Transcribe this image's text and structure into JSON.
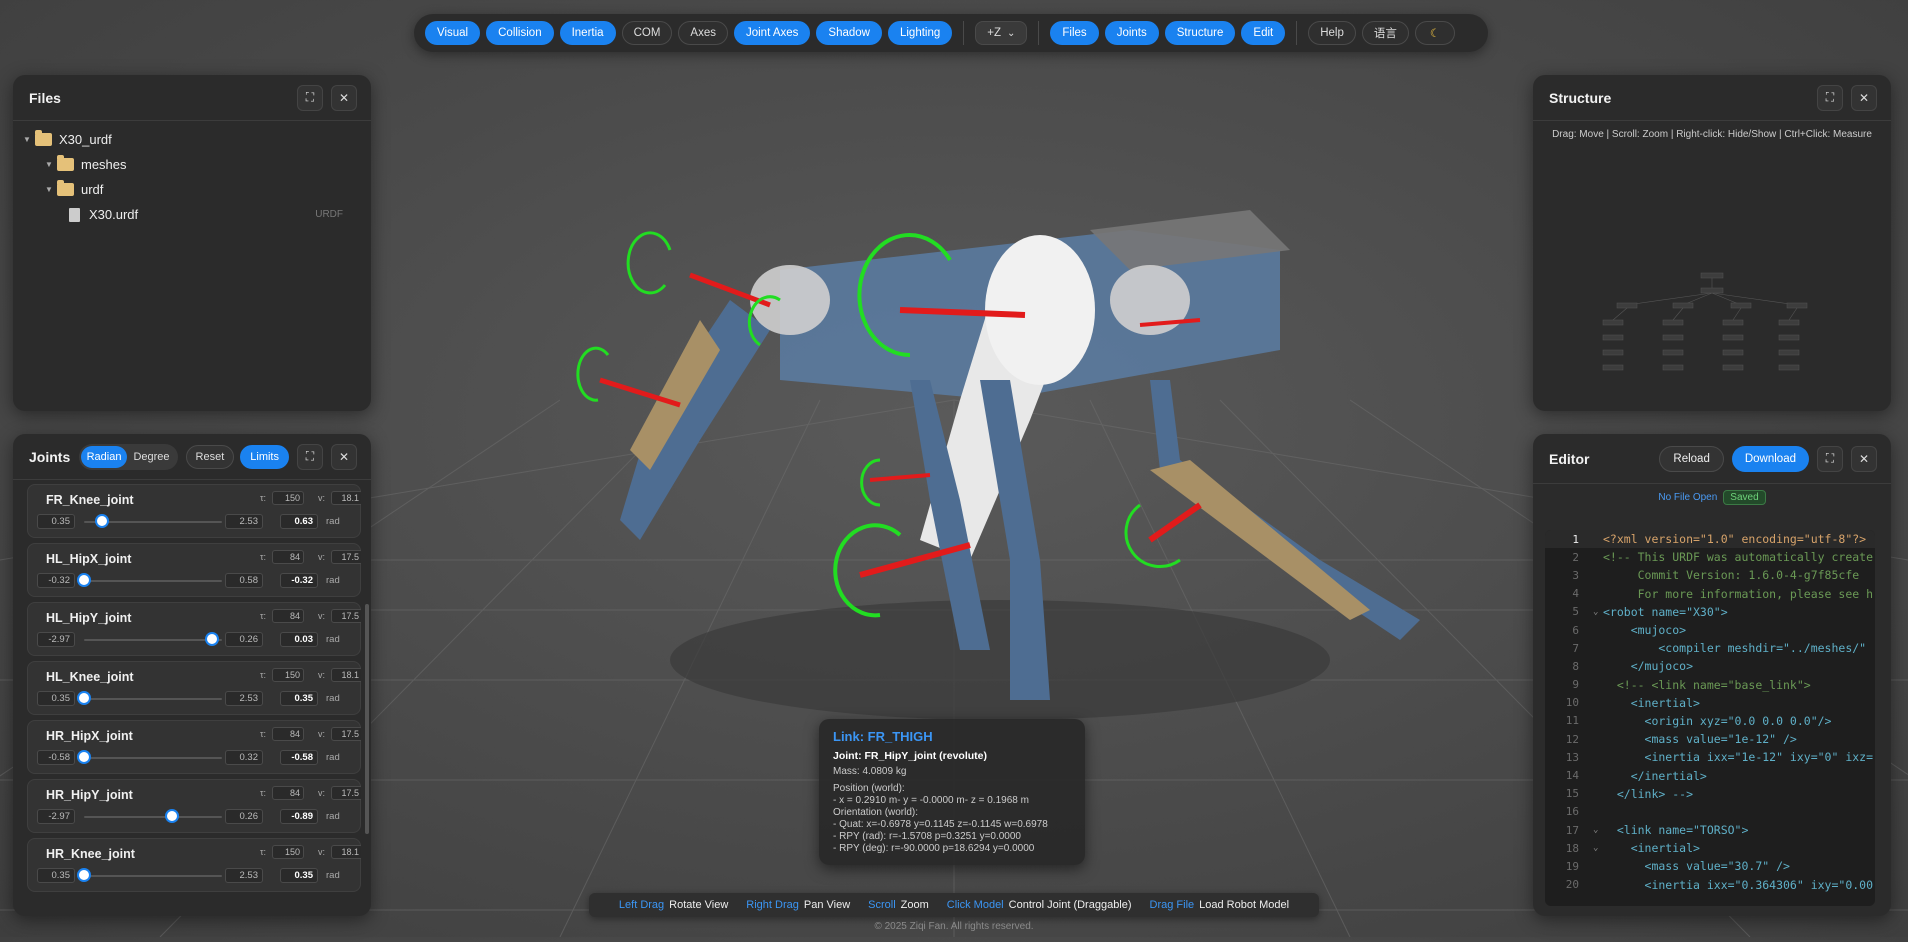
{
  "toolbar": {
    "buttons": [
      {
        "label": "Visual",
        "on": true
      },
      {
        "label": "Collision",
        "on": true
      },
      {
        "label": "Inertia",
        "on": true
      },
      {
        "label": "COM",
        "on": false
      },
      {
        "label": "Axes",
        "on": false
      },
      {
        "label": "Joint Axes",
        "on": true
      },
      {
        "label": "Shadow",
        "on": true
      },
      {
        "label": "Lighting",
        "on": true
      }
    ],
    "up_axis": "+Z",
    "panels": [
      "Files",
      "Joints",
      "Structure",
      "Edit"
    ],
    "help_label": "Help",
    "lang_label": "语言",
    "theme_icon": "moon-icon"
  },
  "files": {
    "title": "Files",
    "tree": [
      {
        "label": "X30_urdf",
        "type": "folder",
        "depth": 0
      },
      {
        "label": "meshes",
        "type": "folder",
        "depth": 1
      },
      {
        "label": "urdf",
        "type": "folder",
        "depth": 1
      },
      {
        "label": "X30.urdf",
        "type": "file",
        "depth": 2,
        "tag": "URDF"
      }
    ]
  },
  "joints": {
    "title": "Joints",
    "radian_label": "Radian",
    "degree_label": "Degree",
    "reset_label": "Reset",
    "limits_label": "Limits",
    "tau_label": "τ:",
    "vel_label": "v:",
    "items": [
      {
        "name": "FR_Knee_joint",
        "tau": "150",
        "vel": "18.1",
        "min": "0.35",
        "max": "2.53",
        "value": "0.63",
        "unit": "rad",
        "frac": 0.13
      },
      {
        "name": "HL_HipX_joint",
        "tau": "84",
        "vel": "17.5",
        "min": "-0.32",
        "max": "0.58",
        "value": "-0.32",
        "unit": "rad",
        "frac": 0.0
      },
      {
        "name": "HL_HipY_joint",
        "tau": "84",
        "vel": "17.5",
        "min": "-2.97",
        "max": "0.26",
        "value": "0.03",
        "unit": "rad",
        "frac": 0.93
      },
      {
        "name": "HL_Knee_joint",
        "tau": "150",
        "vel": "18.1",
        "min": "0.35",
        "max": "2.53",
        "value": "0.35",
        "unit": "rad",
        "frac": 0.0
      },
      {
        "name": "HR_HipX_joint",
        "tau": "84",
        "vel": "17.5",
        "min": "-0.58",
        "max": "0.32",
        "value": "-0.58",
        "unit": "rad",
        "frac": 0.0
      },
      {
        "name": "HR_HipY_joint",
        "tau": "84",
        "vel": "17.5",
        "min": "-2.97",
        "max": "0.26",
        "value": "-0.89",
        "unit": "rad",
        "frac": 0.64
      },
      {
        "name": "HR_Knee_joint",
        "tau": "150",
        "vel": "18.1",
        "min": "0.35",
        "max": "2.53",
        "value": "0.35",
        "unit": "rad",
        "frac": 0.0
      }
    ]
  },
  "structure": {
    "title": "Structure",
    "hint": "Drag: Move | Scroll: Zoom | Right-click: Hide/Show | Ctrl+Click: Measure"
  },
  "editor": {
    "title": "Editor",
    "reload_label": "Reload",
    "download_label": "Download",
    "file_status": "No File Open",
    "save_status": "Saved",
    "lines": [
      {
        "n": "1",
        "text": "<?xml version=\"1.0\" encoding=\"utf-8\"?>",
        "fold": ""
      },
      {
        "n": "2",
        "text": "<!-- This URDF was automatically create",
        "fold": ""
      },
      {
        "n": "3",
        "text": "     Commit Version: 1.6.0-4-g7f85cfe",
        "fold": ""
      },
      {
        "n": "4",
        "text": "     For more information, please see h",
        "fold": ""
      },
      {
        "n": "5",
        "text": "<robot name=\"X30\">",
        "fold": "⌄"
      },
      {
        "n": "6",
        "text": "    <mujoco>",
        "fold": ""
      },
      {
        "n": "7",
        "text": "        <compiler meshdir=\"../meshes/\"",
        "fold": ""
      },
      {
        "n": "8",
        "text": "    </mujoco>",
        "fold": ""
      },
      {
        "n": "9",
        "text": "  <!-- <link name=\"base_link\">",
        "fold": ""
      },
      {
        "n": "10",
        "text": "    <inertial>",
        "fold": ""
      },
      {
        "n": "11",
        "text": "      <origin xyz=\"0.0 0.0 0.0\"/>",
        "fold": ""
      },
      {
        "n": "12",
        "text": "      <mass value=\"1e-12\" />",
        "fold": ""
      },
      {
        "n": "13",
        "text": "      <inertia ixx=\"1e-12\" ixy=\"0\" ixz=",
        "fold": ""
      },
      {
        "n": "14",
        "text": "    </inertial>",
        "fold": ""
      },
      {
        "n": "15",
        "text": "  </link> -->",
        "fold": ""
      },
      {
        "n": "16",
        "text": "",
        "fold": ""
      },
      {
        "n": "17",
        "text": "  <link name=\"TORSO\">",
        "fold": "⌄"
      },
      {
        "n": "18",
        "text": "    <inertial>",
        "fold": "⌄"
      },
      {
        "n": "19",
        "text": "      <mass value=\"30.7\" />",
        "fold": ""
      },
      {
        "n": "20",
        "text": "      <inertia ixx=\"0.364306\" ixy=\"0.00",
        "fold": ""
      }
    ]
  },
  "info": {
    "title": "Link: FR_THIGH",
    "joint": "Joint: FR_HipY_joint (revolute)",
    "mass": "Mass: 4.0809 kg",
    "pos_label": "Position (world):",
    "pos_value": "- x = 0.2910 m- y = -0.0000 m- z = 0.1968 m",
    "orient_label": "Orientation (world):",
    "quat": "- Quat: x=-0.6978 y=0.1145 z=-0.1145 w=0.6978",
    "rpy_rad": "- RPY (rad): r=-1.5708 p=0.3251 y=0.0000",
    "rpy_deg": "- RPY (deg): r=-90.0000 p=18.6294 y=0.0000"
  },
  "hints": [
    {
      "key": "Left Drag",
      "value": "Rotate View"
    },
    {
      "key": "Right Drag",
      "value": "Pan View"
    },
    {
      "key": "Scroll",
      "value": "Zoom"
    },
    {
      "key": "Click Model",
      "value": "Control Joint (Draggable)"
    },
    {
      "key": "Drag File",
      "value": "Load Robot Model"
    }
  ],
  "copyright": "© 2025 Ziqi Fan. All rights reserved."
}
